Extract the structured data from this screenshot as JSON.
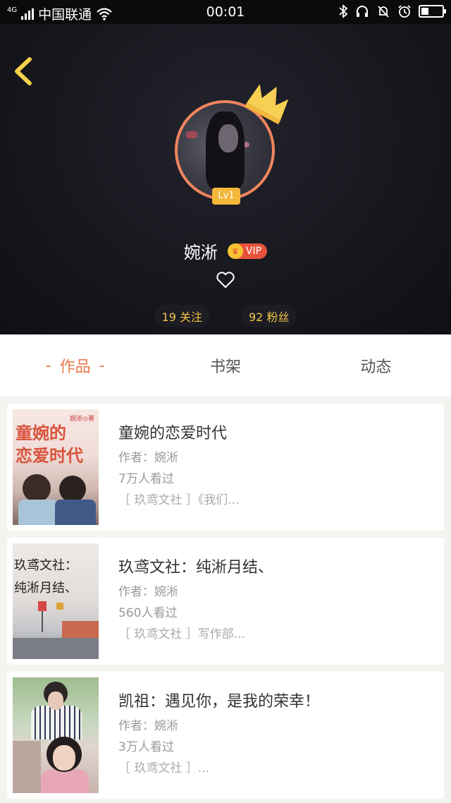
{
  "status_bar": {
    "network": "4G",
    "carrier": "中国联通",
    "time": "00:01",
    "icons": [
      "signal-icon",
      "wifi-icon",
      "bluetooth-icon",
      "headset-icon",
      "mute-icon",
      "alarm-icon",
      "battery-icon"
    ],
    "battery_level": 0.35
  },
  "profile": {
    "level": "Lv1",
    "username": "婉淅",
    "vip_label": "VIP",
    "following": "19 关注",
    "followers": "92 粉丝"
  },
  "tabs": [
    {
      "label": "作品",
      "active": true
    },
    {
      "label": "书架",
      "active": false
    },
    {
      "label": "动态",
      "active": false
    }
  ],
  "works": [
    {
      "title": "童婉的恋爱时代",
      "author": "作者：婉淅",
      "views": "7万人看过",
      "desc": "［ 玖鸢文社 ］《我们...",
      "cover_text": "童婉的\n恋爱时代",
      "cover_small": "婉淅◎著"
    },
    {
      "title": "玖鸢文社：纯淅月结、",
      "author": "作者：婉淅",
      "views": "560人看过",
      "desc": "［ 玖鸢文社 ］写作部...",
      "cover_text": "玖鸢文社：\n纯淅月结、"
    },
    {
      "title": "凯祖：遇见你，是我的荣幸！",
      "author": "作者：婉淅",
      "views": "3万人看过",
      "desc": "［ 玖鸢文社 ］..."
    }
  ],
  "colors": {
    "accent": "#ee7a4e",
    "avatar_ring": "#f0855d",
    "gold": "#f1c54a",
    "vip_red": "#e8523d",
    "header_bg": "#17171e"
  }
}
